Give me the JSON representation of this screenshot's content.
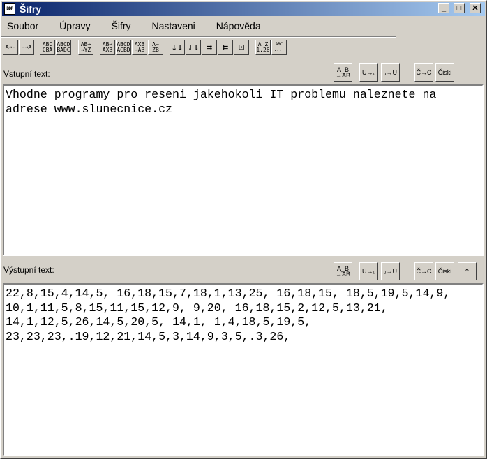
{
  "window": {
    "title": "Šifry",
    "icon_text": "BDP",
    "minimize": "_",
    "maximize": "□",
    "close": "✕"
  },
  "menu": [
    "Soubor",
    "Úpravy",
    "Šifry",
    "Nastaveni",
    "Nápověda"
  ],
  "toolbar": [
    "A→-",
    "-→A",
    "ABC\nCBA",
    "ABCD\nBADC",
    "AB→\n→YZ",
    "AB→\nAXB",
    "ABCD\nACBD",
    "AXB\n→AB",
    "A→\nZB",
    "↓↓",
    "⇃⇂",
    "⇉",
    "⇇",
    "⊡",
    "A Z\n1.26",
    "ABC\n...."
  ],
  "input": {
    "label": "Vstupní text:",
    "value": "Vhodne programy pro reseni jakehokoli IT problemu naleznete na adrese www.slunecnice.cz"
  },
  "output": {
    "label": "Výstupní text:",
    "value": "22,8,15,4,14,5, 16,18,15,7,18,1,13,25, 16,18,15, 18,5,19,5,14,9,\n10,1,11,5,8,15,11,15,12,9, 9,20, 16,18,15,2,12,5,13,21,\n14,1,12,5,26,14,5,20,5, 14,1, 1,4,18,5,19,5,\n23,23,23,.19,12,21,14,5,3,14,9,3,5,.3,26,"
  },
  "side_buttons": [
    "A_B\n→AB",
    "U→ᵤ",
    "ᵤ→U",
    "Č→C",
    "Čiski"
  ],
  "move_up": "↑"
}
